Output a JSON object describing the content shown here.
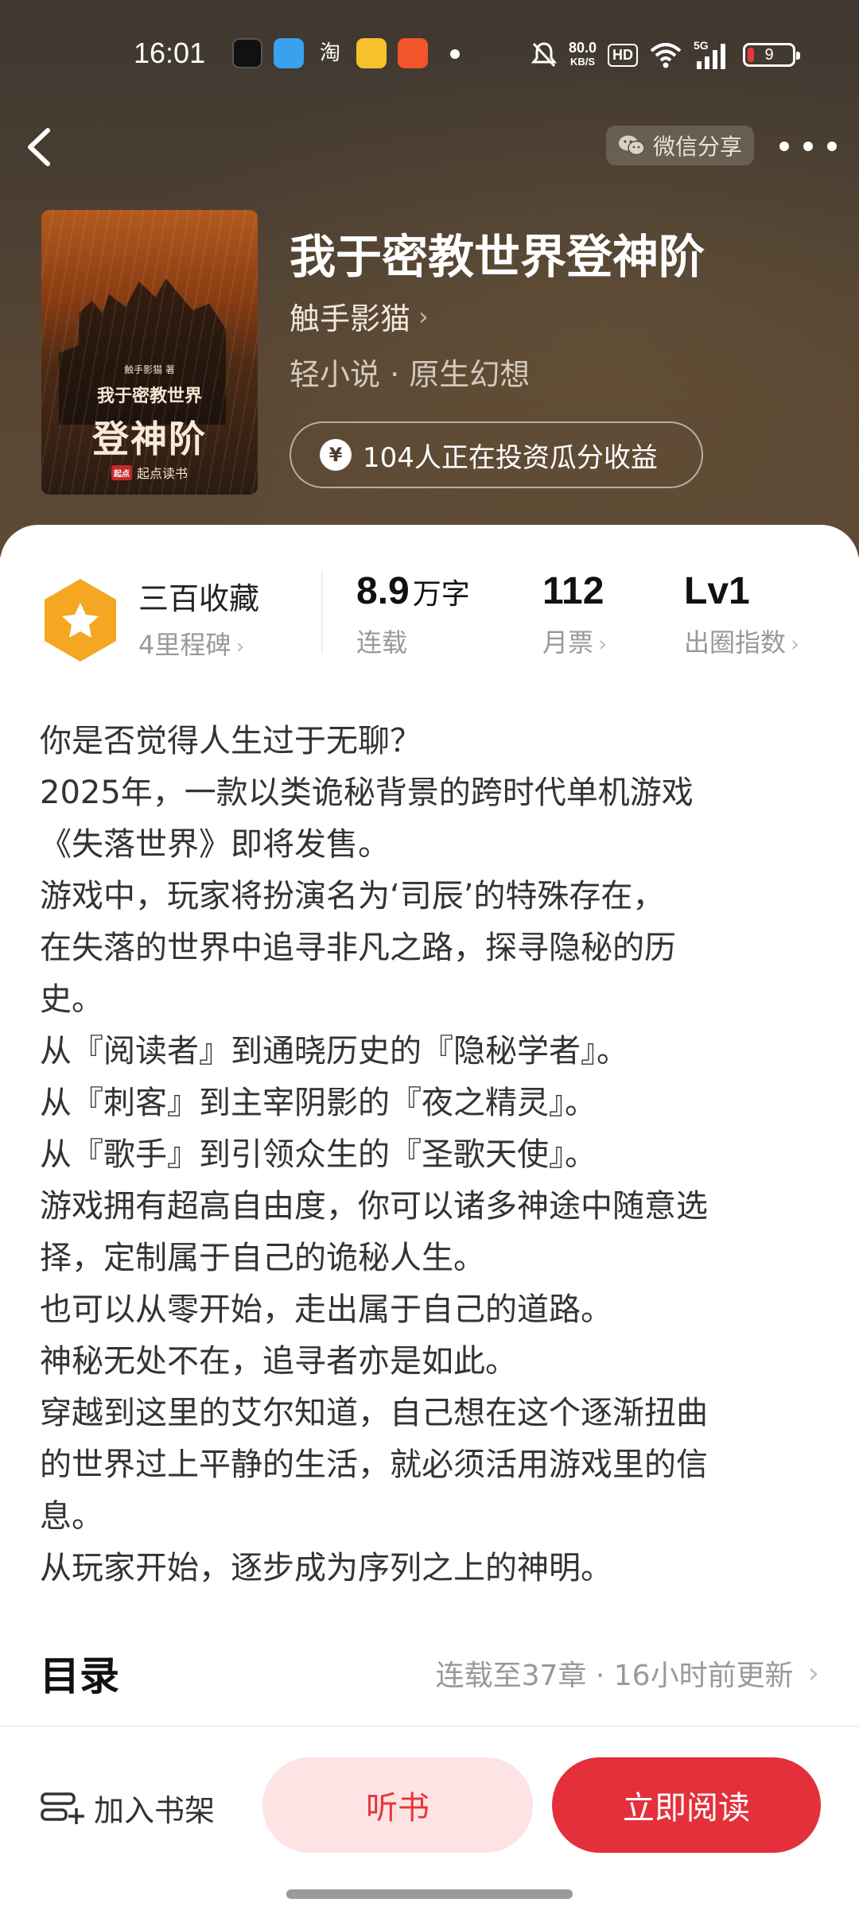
{
  "status_bar": {
    "time": "16:01",
    "network_speed_value": "80.0",
    "network_speed_unit": "KB/S",
    "hd_label": "HD",
    "signal_label": "5G",
    "battery_level": "9",
    "app_icons": [
      "tiktok-icon",
      "blue-app-icon",
      "taobao-icon",
      "weibo-icon",
      "video-app-icon"
    ]
  },
  "nav": {
    "share_label": "微信分享"
  },
  "book": {
    "title": "我于密教世界登神阶",
    "author": "触手影猫",
    "genre": "轻小说 · 原生幻想",
    "invest_text": "104人正在投资瓜分收益",
    "cover": {
      "author": "触手影猫 著",
      "title_line1": "我于密教世界",
      "title_line2": "登神阶",
      "publisher": "起点读书",
      "publisher_badge": "起点"
    }
  },
  "stats": {
    "favorites_title": "三百收藏",
    "favorites_sub": "4里程碑",
    "words_num": "8.9",
    "words_unit": "万字",
    "words_label": "连载",
    "monthly_votes": "112",
    "monthly_label": "月票",
    "level": "Lv1",
    "level_label": "出圈指数"
  },
  "synopsis": [
    "你是否觉得人生过于无聊？",
    "2025年，一款以类诡秘背景的跨时代单机游戏",
    "《失落世界》即将发售。",
    "游戏中，玩家将扮演名为‘司辰’的特殊存在，",
    "在失落的世界中追寻非凡之路，探寻隐秘的历",
    "史。",
    "从『阅读者』到通晓历史的『隐秘学者』。",
    "从『刺客』到主宰阴影的『夜之精灵』。",
    "从『歌手』到引领众生的『圣歌天使』。",
    "游戏拥有超高自由度，你可以诸多神途中随意选",
    "择，定制属于自己的诡秘人生。",
    "也可以从零开始，走出属于自己的道路。",
    "神秘无处不在，追寻者亦是如此。",
    "穿越到这里的艾尔知道，自己想在这个逐渐扭曲",
    "的世界过上平静的生活，就必须活用游戏里的信",
    "息。",
    "从玩家开始，逐步成为序列之上的神明。"
  ],
  "toc": {
    "title": "目录",
    "status": "连载至37章 · 16小时前更新"
  },
  "actions": {
    "shelf_label": "加入书架",
    "listen_label": "听书",
    "read_label": "立即阅读"
  },
  "colors": {
    "accent_red": "#e3303a",
    "listen_bg": "#fde3e3",
    "badge_orange": "#f5a623"
  }
}
